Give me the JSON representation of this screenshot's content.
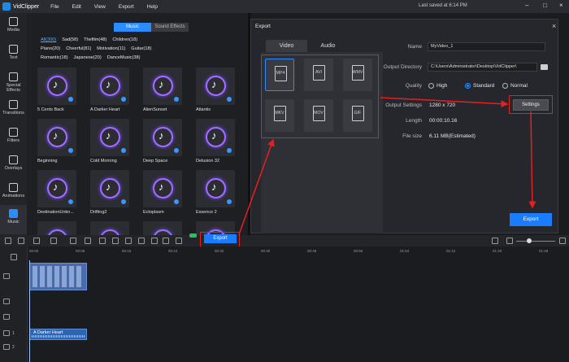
{
  "titlebar": {
    "app_name": "VidClipper",
    "menu": [
      "File",
      "Edit",
      "View",
      "Export",
      "Help"
    ],
    "last_saved": "Last saved at 6:14 PM"
  },
  "sidebar": {
    "items": [
      {
        "label": "Media",
        "icon": "media-icon"
      },
      {
        "label": "Text",
        "icon": "text-icon"
      },
      {
        "label": "Special Effects",
        "icon": "special-effects-icon"
      },
      {
        "label": "Transitions",
        "icon": "transitions-icon"
      },
      {
        "label": "Filters",
        "icon": "filters-icon"
      },
      {
        "label": "Overlays",
        "icon": "overlays-icon"
      },
      {
        "label": "Animations",
        "icon": "animations-icon"
      },
      {
        "label": "Music",
        "icon": "music-icon",
        "active": true
      }
    ]
  },
  "library": {
    "tabs": [
      "Music",
      "Sound Effects"
    ],
    "categories": [
      "All(300)",
      "Sad(58)",
      "Thefilm(48)",
      "Children(18)",
      "Piano(20)",
      "Cheerful(81)",
      "Motivation(11)",
      "Guitar(18)",
      "Romantic(18)",
      "Japanese(20)",
      "DanceMusic(38)"
    ],
    "tracks": [
      "5 Cents Back",
      "A Darker Heart",
      "AlienSunset",
      "Atlantis",
      "Beginning",
      "Cold Morning",
      "Deep Space",
      "Delusion 32",
      "DestinationUnkn...",
      "Drifting2",
      "Ectoplasm",
      "Essence 2",
      "",
      "",
      "",
      ""
    ]
  },
  "dialog": {
    "title": "Export",
    "tabs": [
      "Video",
      "Audio"
    ],
    "formats": [
      "MP4",
      "AVI",
      "WMV",
      "MKV",
      "MOV",
      "GIF"
    ],
    "selected_format": "MP4",
    "name_label": "Name",
    "name_value": "MyVideo_1",
    "output_dir_label": "Output Directory",
    "output_dir_value": "C:\\Users\\Administrator\\Desktop\\VidClipper\\",
    "quality_label": "Quality",
    "quality_options": [
      "High",
      "Standard",
      "Normal"
    ],
    "quality_selected": "Standard",
    "output_settings_label": "Output Settings",
    "output_settings_value": "1280 x 720",
    "settings_button": "Settings",
    "length_label": "Length",
    "length_value": "00:00:10.16",
    "file_size_label": "File size",
    "file_size_value": "6.11 MB(Estimated)",
    "export_button": "Export"
  },
  "toolbar": {
    "export_button": "Export"
  },
  "timeline": {
    "ticks": [
      "00:00",
      "00:08",
      "00:16",
      "00:24",
      "00:32",
      "00:40",
      "00:48",
      "00:56",
      "01:04",
      "01:12",
      "01:20",
      "01:28"
    ],
    "audio_clip": "A Darker Heart",
    "track_numbers": [
      "1",
      "1",
      "2"
    ]
  },
  "colors": {
    "accent": "#1a7cff",
    "highlight": "#e52020",
    "background": "#1b1c20"
  }
}
